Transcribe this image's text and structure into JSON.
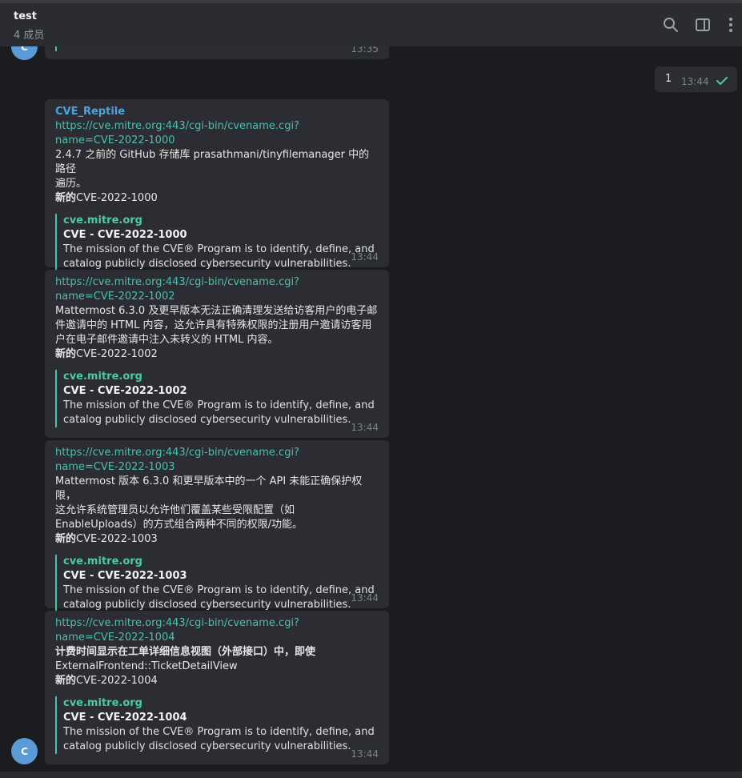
{
  "header": {
    "title": "test",
    "subtitle": "4 成员",
    "icons": [
      "search-icon",
      "sidebar-toggle-icon",
      "more-vertical-icon"
    ]
  },
  "top_partial": {
    "avatar_letter": "C",
    "time": "13:35"
  },
  "outgoing": {
    "text": "1",
    "time": "13:44",
    "status_icon": "check-icon"
  },
  "messages": [
    {
      "sender": "CVE_Reptile",
      "url_line1": "https://cve.mitre.org:443/cgi-bin/cvename.cgi?",
      "url_line2": "name=CVE-2022-1000",
      "desc_lines": [
        "2.4.7 之前的 GitHub 存储库 prasathmani/tinyfilemanager 中的路径",
        "遍历。"
      ],
      "new_label": "新的",
      "new_id": "CVE-2022-1000",
      "preview_site": "cve.mitre.org",
      "preview_title": "CVE - CVE-2022-1000",
      "preview_desc_lines": [
        "The mission of the CVE® Program is to identify, define, and",
        "catalog publicly disclosed cybersecurity vulnerabilities."
      ],
      "time": "13:44"
    },
    {
      "url_line1": "https://cve.mitre.org:443/cgi-bin/cvename.cgi?",
      "url_line2": "name=CVE-2022-1002",
      "desc_lines": [
        "Mattermost 6.3.0 及更早版本无法正确清理发送给访客用户的电子邮",
        "件邀请中的 HTML 内容，这允许具有特殊权限的注册用户邀请访客用",
        "户在电子邮件邀请中注入未转义的 HTML 内容。"
      ],
      "new_label": "新的",
      "new_id": "CVE-2022-1002",
      "preview_site": "cve.mitre.org",
      "preview_title": "CVE - CVE-2022-1002",
      "preview_desc_lines": [
        "The mission of the CVE® Program is to identify, define, and",
        "catalog publicly disclosed cybersecurity vulnerabilities."
      ],
      "time": "13:44"
    },
    {
      "url_line1": "https://cve.mitre.org:443/cgi-bin/cvename.cgi?",
      "url_line2": "name=CVE-2022-1003",
      "desc_lines": [
        "Mattermost 版本 6.3.0 和更早版本中的一个 API 未能正确保护权限，",
        "这允许系统管理员以允许他们覆盖某些受限配置（如",
        "EnableUploads）的方式组合两种不同的权限/功能。"
      ],
      "new_label": "新的",
      "new_id": "CVE-2022-1003",
      "preview_site": "cve.mitre.org",
      "preview_title": "CVE - CVE-2022-1003",
      "preview_desc_lines": [
        "The mission of the CVE® Program is to identify, define, and",
        "catalog publicly disclosed cybersecurity vulnerabilities."
      ],
      "time": "13:44"
    },
    {
      "url_line1": "https://cve.mitre.org:443/cgi-bin/cvename.cgi?",
      "url_line2": "name=CVE-2022-1004",
      "desc_lines": [
        "计费时间显示在工单详细信息视图（外部接口）中，即使",
        "ExternalFrontend::TicketDetailView"
      ],
      "new_label": "新的",
      "new_id": "CVE-2022-1004",
      "preview_site": "cve.mitre.org",
      "preview_title": "CVE - CVE-2022-1004",
      "preview_desc_lines": [
        "The mission of the CVE® Program is to identify, define, and",
        "catalog publicly disclosed cybersecurity vulnerabilities."
      ],
      "time": "13:44",
      "avatar_letter": "C"
    }
  ],
  "colors": {
    "background": "#1b1c1f",
    "bubble": "#2b2d32",
    "link": "#4cbfb0",
    "sender": "#4da3e0",
    "preview_bar": "#47c1a8",
    "avatar": "#5b9bd5",
    "check": "#4cc9a5"
  }
}
